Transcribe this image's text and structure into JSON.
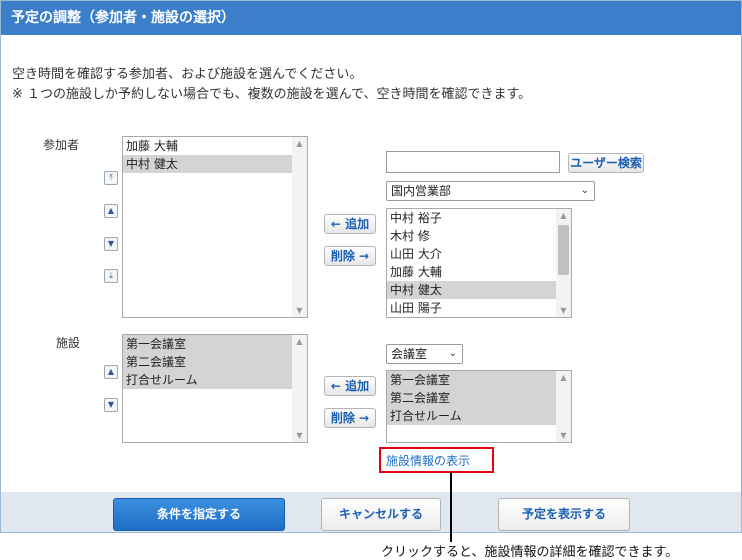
{
  "dialog": {
    "title": "予定の調整（参加者・施設の選択）",
    "intro_line1": "空き時間を確認する参加者、および施設を選んでください。",
    "intro_line2": "※ １つの施設しか予約しない場合でも、複数の施設を選んで、空き時間を確認できます。"
  },
  "participants": {
    "label": "参加者",
    "selected": [
      {
        "name": "加藤 大輔",
        "selected": false
      },
      {
        "name": "中村 健太",
        "selected": true
      }
    ],
    "add_label": "← 追加",
    "remove_label": "削除 →",
    "search_value": "",
    "user_search_label": "ユーザー検索",
    "group_selected": "国内営業部",
    "candidates": [
      {
        "name": "中村 裕子",
        "selected": false
      },
      {
        "name": "木村 修",
        "selected": false
      },
      {
        "name": "山田 大介",
        "selected": false
      },
      {
        "name": "加藤 大輔",
        "selected": false
      },
      {
        "name": "中村 健太",
        "selected": true
      },
      {
        "name": "山田 陽子",
        "selected": false
      }
    ]
  },
  "facilities": {
    "label": "施設",
    "selected": [
      {
        "name": "第一会議室",
        "selected": true
      },
      {
        "name": "第二会議室",
        "selected": true
      },
      {
        "name": "打合せルーム",
        "selected": true
      }
    ],
    "add_label": "← 追加",
    "remove_label": "削除 →",
    "group_selected": "会議室",
    "candidates": [
      {
        "name": "第一会議室",
        "selected": true
      },
      {
        "name": "第二会議室",
        "selected": true
      },
      {
        "name": "打合せルーム",
        "selected": true
      }
    ],
    "info_link": "施設情報の表示"
  },
  "footer": {
    "specify_label": "条件を指定する",
    "cancel_label": "キャンセルする",
    "show_label": "予定を表示する"
  },
  "callout": {
    "text": "クリックすると、施設情報の詳細を確認できます。"
  },
  "colors": {
    "title_bar": "#3b7fcb",
    "primary_button": "#1e6ec6",
    "link": "#1a6fc4",
    "highlight": "#e60012"
  }
}
